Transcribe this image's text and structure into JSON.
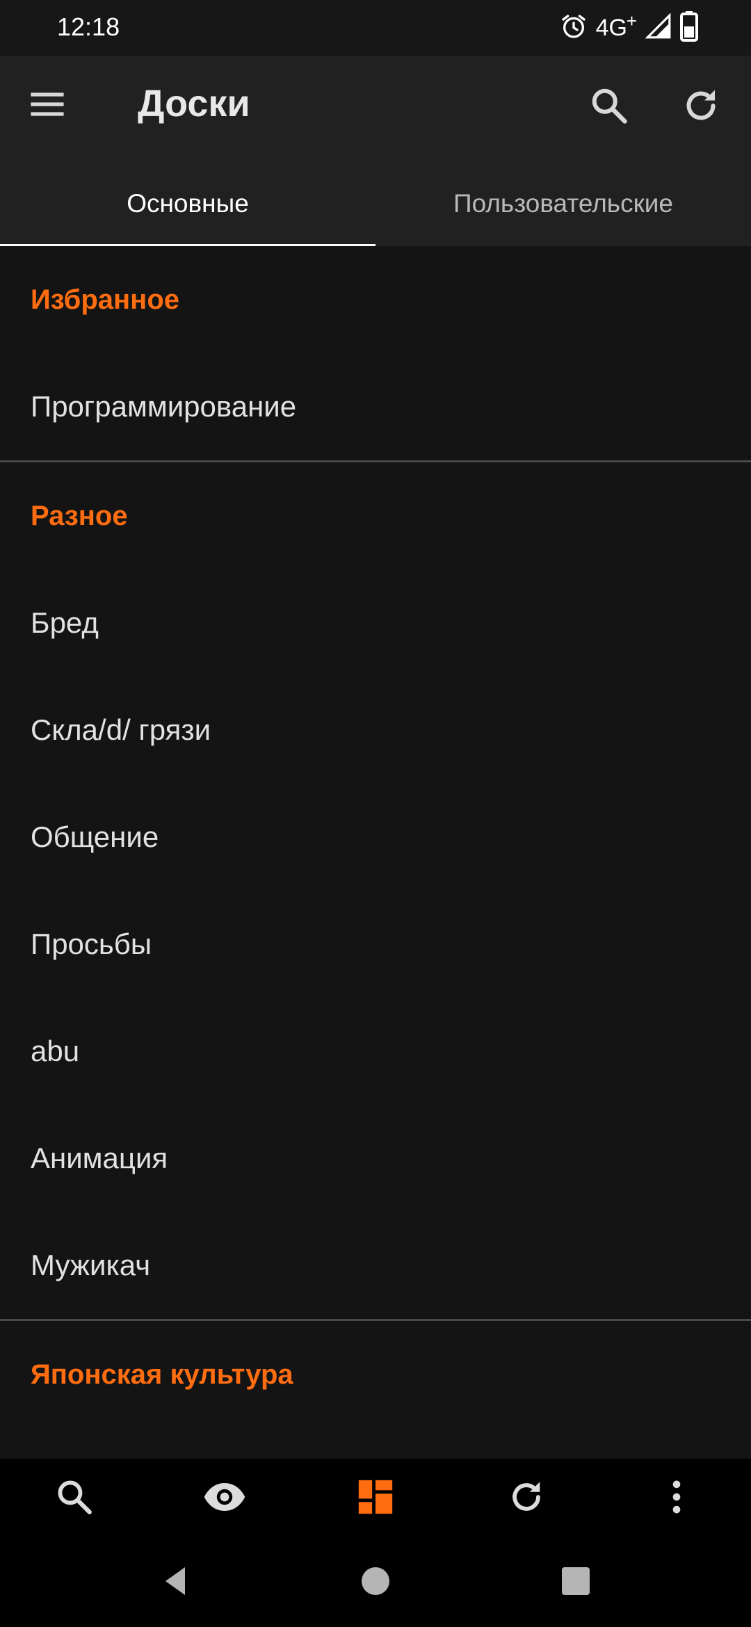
{
  "status_bar": {
    "time": "12:18",
    "network": "4G",
    "network_plus": "+",
    "icons": [
      "alarm-icon",
      "signal-icon",
      "battery-icon"
    ]
  },
  "app_bar": {
    "title": "Доски",
    "icons": [
      "menu-icon",
      "search-icon",
      "refresh-icon"
    ]
  },
  "tabs": [
    {
      "label": "Основные",
      "active": true
    },
    {
      "label": "Пользовательские",
      "active": false
    }
  ],
  "sections": {
    "favorites": {
      "title": "Избранное",
      "items": [
        "Программирование"
      ]
    },
    "misc": {
      "title": "Разное",
      "items": [
        "Бред",
        "Скла/d/ грязи",
        "Общение",
        "Просьбы",
        "abu",
        "Анимация",
        "Мужикач"
      ]
    },
    "japanese": {
      "title": "Японская культура"
    }
  },
  "bottom_nav": {
    "icons": [
      "search-icon",
      "eye-icon",
      "boards-icon",
      "refresh-icon",
      "more-icon"
    ],
    "active": "boards-icon"
  },
  "system_nav": {
    "icons": [
      "back-icon",
      "home-icon",
      "recents-icon"
    ]
  },
  "colors": {
    "accent": "#ff6d10",
    "background": "#141414",
    "toolbar": "#212121",
    "text": "#e2e2e2",
    "divider": "#4a4a4a"
  }
}
